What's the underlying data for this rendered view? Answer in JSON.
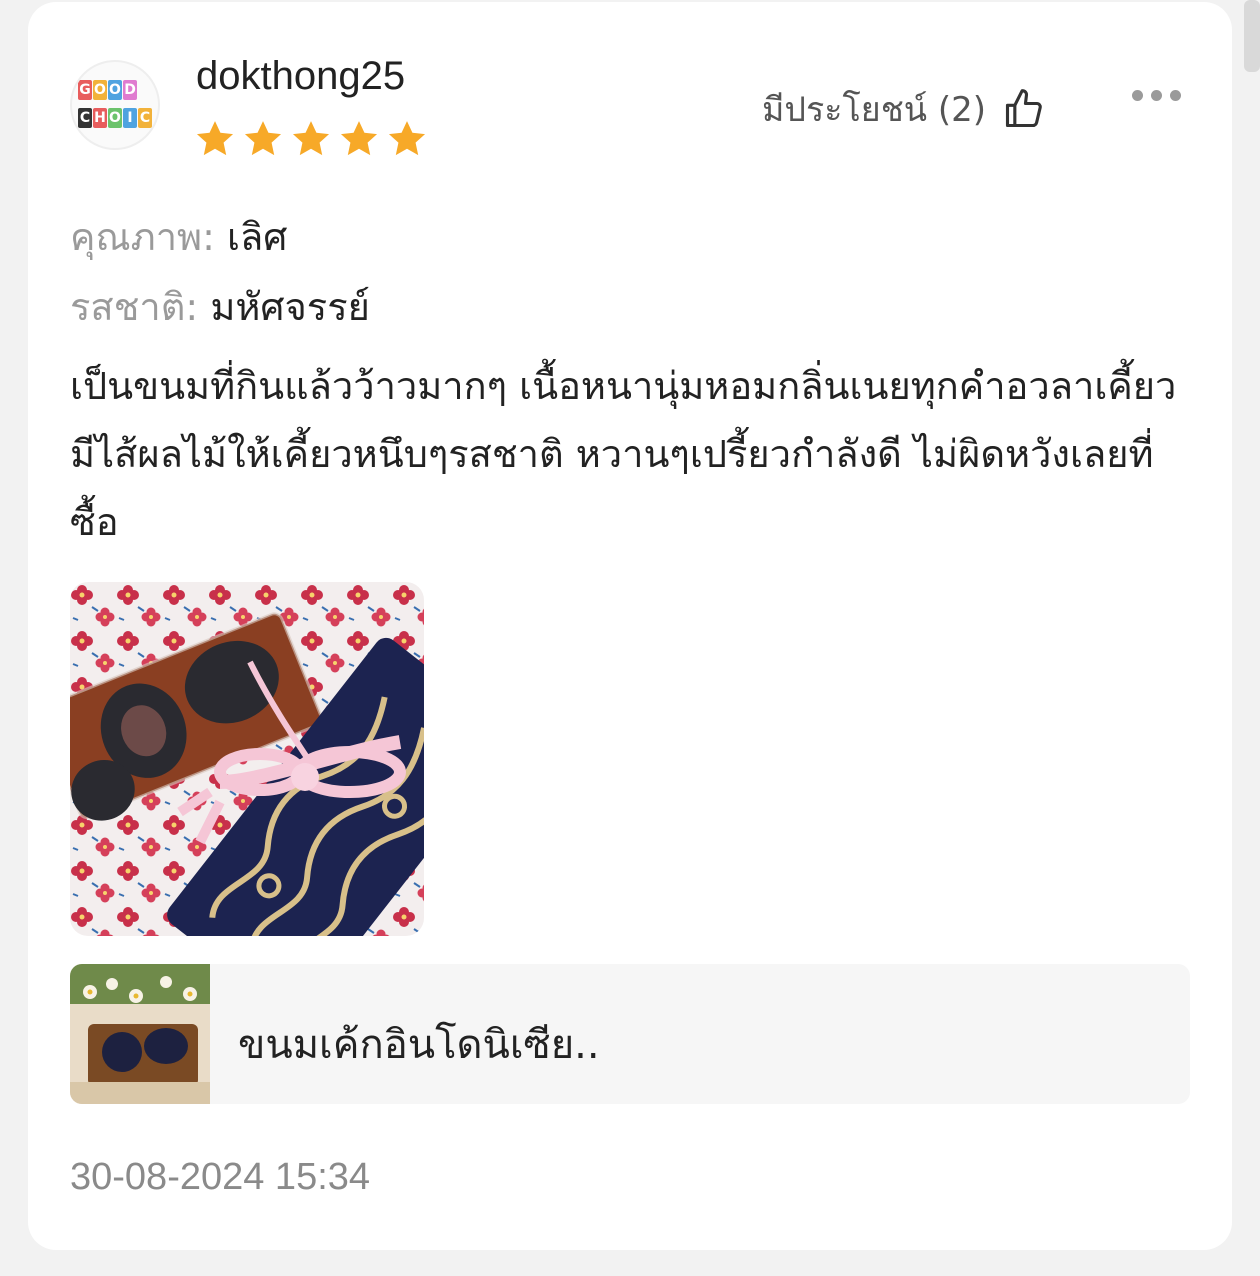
{
  "review": {
    "username": "dokthong25",
    "rating": 5,
    "rating_max": 5,
    "star_color": "#F7A928",
    "helpful_label": "มีประโยชน์ (2)",
    "attributes": [
      {
        "label": "คุณภาพ:",
        "value": "เลิศ"
      },
      {
        "label": "รสชาติ:",
        "value": "มหัศจรรย์"
      }
    ],
    "text": "เป็นขนมที่กินแล้วว้าวมากๆ เนื้อหนานุ่มหอมกลิ่นเนยทุกคำอวลาเคี้ยว มีไส้ผลไม้ให้เคี้ยวหนึบๆรสชาติ หวานๆเปรี้ยวกำลังดี ไม่ผิดหวังเลยที่ซื้อ",
    "product_name": "ขนมเค้กอินโดนิเซีย..",
    "date": "30-08-2024 15:34"
  },
  "icons": {
    "like": "thumbs-up-icon",
    "more": "more-dots-icon"
  }
}
